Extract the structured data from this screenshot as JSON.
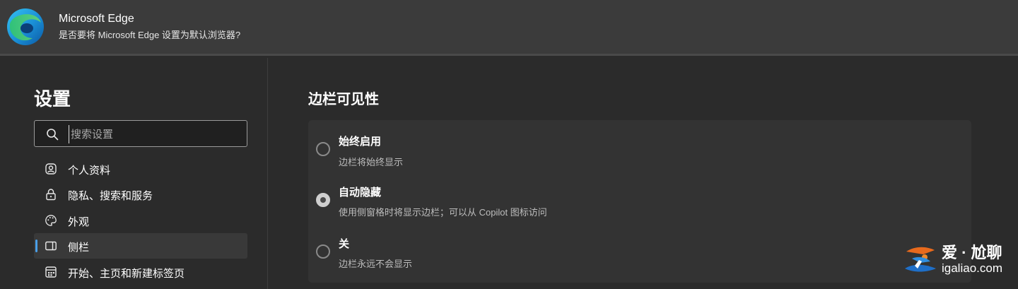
{
  "banner": {
    "title": "Microsoft Edge",
    "subtitle": "是否要将 Microsoft Edge 设置为默认浏览器?",
    "logo_icon": "edge-logo-icon"
  },
  "sidebar": {
    "title": "设置",
    "search": {
      "placeholder": "搜索设置",
      "value": ""
    },
    "items": [
      {
        "label": "个人资料",
        "icon": "profile-icon",
        "active": false
      },
      {
        "label": "隐私、搜索和服务",
        "icon": "lock-icon",
        "active": false
      },
      {
        "label": "外观",
        "icon": "palette-icon",
        "active": false
      },
      {
        "label": "侧栏",
        "icon": "sidebar-icon",
        "active": true
      },
      {
        "label": "开始、主页和新建标签页",
        "icon": "home-grid-icon",
        "active": false
      }
    ]
  },
  "main": {
    "section_title": "边栏可见性",
    "options": [
      {
        "title": "始终启用",
        "desc": "边栏将始终显示",
        "checked": false
      },
      {
        "title": "自动隐藏",
        "desc": "使用侧窗格时将显示边栏；可以从 Copilot 图标访问",
        "checked": true
      },
      {
        "title": "关",
        "desc": "边栏永远不会显示",
        "checked": false
      }
    ]
  },
  "watermark": {
    "text": "爱 · 尬聊",
    "url": "igaliao.com"
  },
  "colors": {
    "banner_bg": "#3b3b3b",
    "page_bg": "#2b2b2b",
    "card_bg": "#333333",
    "active_item_bg": "#393939",
    "accent": "#4a9fe8"
  }
}
